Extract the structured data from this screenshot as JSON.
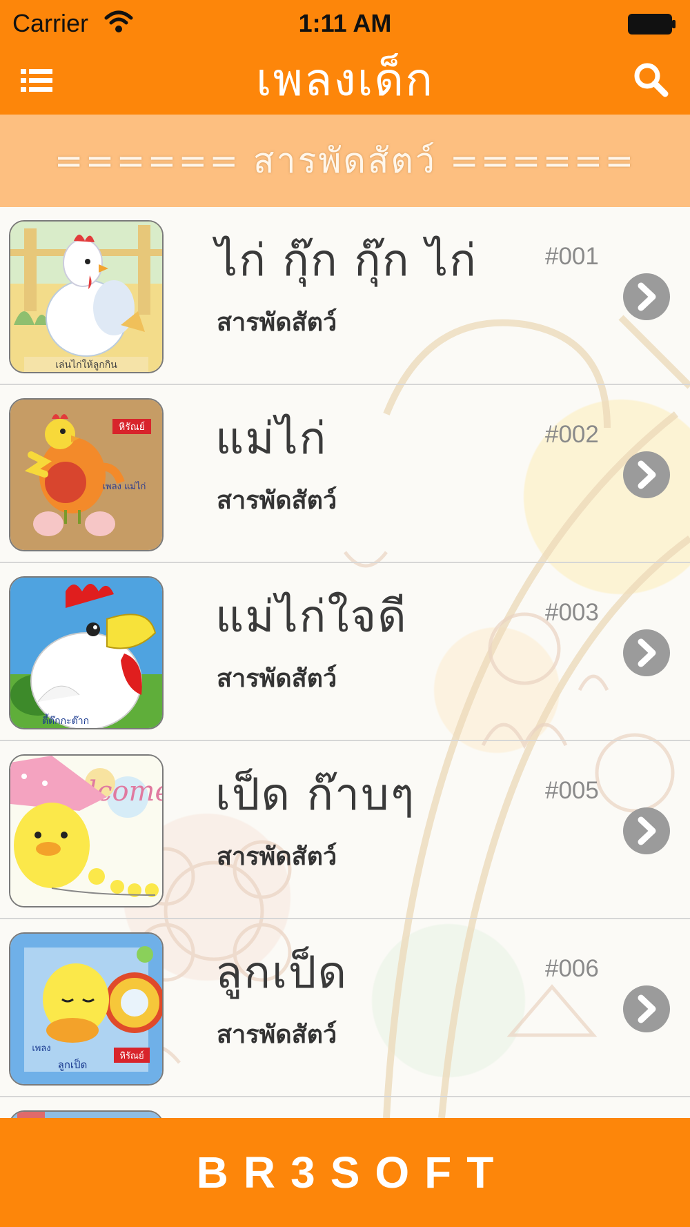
{
  "status_bar": {
    "carrier": "Carrier",
    "time": "1:11 AM"
  },
  "nav": {
    "title": "เพลงเด็ก",
    "menu_icon": "list-icon",
    "search_icon": "search-icon"
  },
  "section": {
    "title": "======  สารพัดสัตว์  ======"
  },
  "songs": [
    {
      "title": "ไก่  กุ๊ก  กุ๊ก  ไก่",
      "category": "สารพัดสัตว์",
      "number": "#001"
    },
    {
      "title": "แม่ไก่",
      "category": "สารพัดสัตว์",
      "number": "#002"
    },
    {
      "title": "แม่ไก่ใจดี",
      "category": "สารพัดสัตว์",
      "number": "#003"
    },
    {
      "title": "เป็ด  ก๊าบๆ",
      "category": "สารพัดสัตว์",
      "number": "#005"
    },
    {
      "title": "ลูกเป็ด",
      "category": "สารพัดสัตว์",
      "number": "#006"
    }
  ],
  "footer": {
    "brand": "BR3SOFT"
  },
  "colors": {
    "accent": "#fd860a",
    "section_bg": "#fdbf80",
    "chevron": "#9b9b9b"
  }
}
